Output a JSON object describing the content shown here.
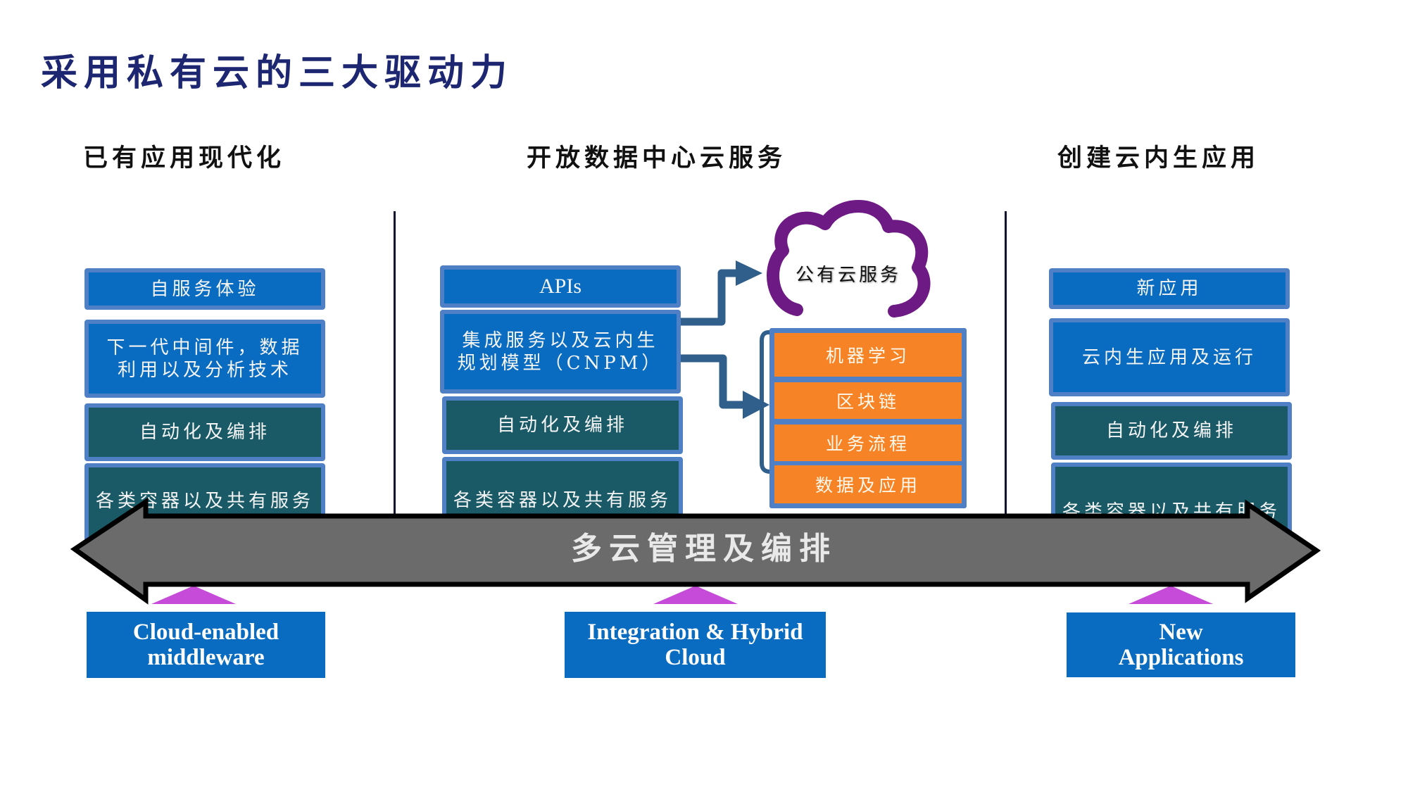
{
  "title": "采用私有云的三大驱动力",
  "columns": [
    {
      "heading": "已有应用现代化",
      "stack": [
        {
          "label": "自服务体验",
          "style": "blue"
        },
        {
          "label": "下一代中间件，数据利用以及分析技术",
          "style": "blue"
        },
        {
          "label": "自动化及编排",
          "style": "teal"
        },
        {
          "label": "各类容器以及共有服务",
          "style": "teal"
        }
      ],
      "bottom_label": "Cloud-enabled middleware"
    },
    {
      "heading": "开放数据中心云服务",
      "stack": [
        {
          "label": "APIs",
          "style": "blue"
        },
        {
          "label": "集成服务以及云内生规划模型（CNPM）",
          "style": "blue"
        },
        {
          "label": "自动化及编排",
          "style": "teal"
        },
        {
          "label": "各类容器以及共有服务",
          "style": "teal"
        }
      ],
      "cloud_label": "公有云服务",
      "services": [
        "机器学习",
        "区块链",
        "业务流程",
        "数据及应用"
      ],
      "bottom_label": "Integration & Hybrid Cloud"
    },
    {
      "heading": "创建云内生应用",
      "stack": [
        {
          "label": "新应用",
          "style": "blue"
        },
        {
          "label": "云内生应用及运行",
          "style": "blue"
        },
        {
          "label": "自动化及编排",
          "style": "teal"
        },
        {
          "label": "各类容器以及共有服务",
          "style": "teal"
        }
      ],
      "bottom_label": "New Applications"
    }
  ],
  "banner_label": "多云管理及编排",
  "colors": {
    "title": "#1d2670",
    "box_blue": "#0a6cc0",
    "box_teal": "#195a66",
    "box_border": "#4f7fc4",
    "orange": "#f68426",
    "cloud_purple": "#6e1a84",
    "connector": "#2f5f8a",
    "banner_gray": "#6b6b6b",
    "marker_magenta": "#c64bd9"
  }
}
